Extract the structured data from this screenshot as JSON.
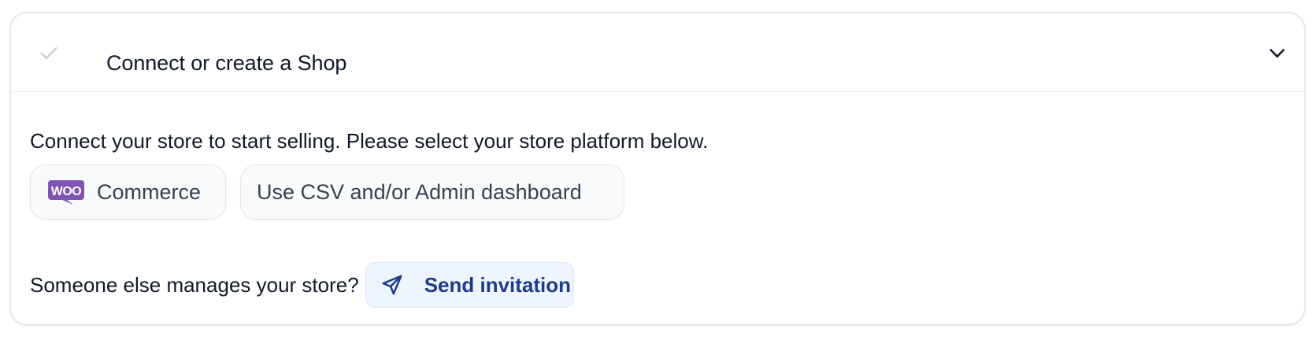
{
  "step": {
    "title": "Connect or create a Shop",
    "status_icon": "check-icon",
    "toggle_icon": "chevron-down-icon"
  },
  "content": {
    "description": "Connect your store to start selling. Please select your store platform below.",
    "platforms": [
      {
        "logo": "WOO",
        "label": "Commerce"
      },
      {
        "label": "Use CSV and/or Admin dashboard"
      }
    ],
    "invite": {
      "prompt": "Someone else manages your store?",
      "button_label": "Send invitation",
      "icon": "send-icon"
    }
  },
  "colors": {
    "woo_purple": "#7f54b3",
    "invite_text": "#1e3a8a",
    "invite_bg": "#eff5fe"
  }
}
